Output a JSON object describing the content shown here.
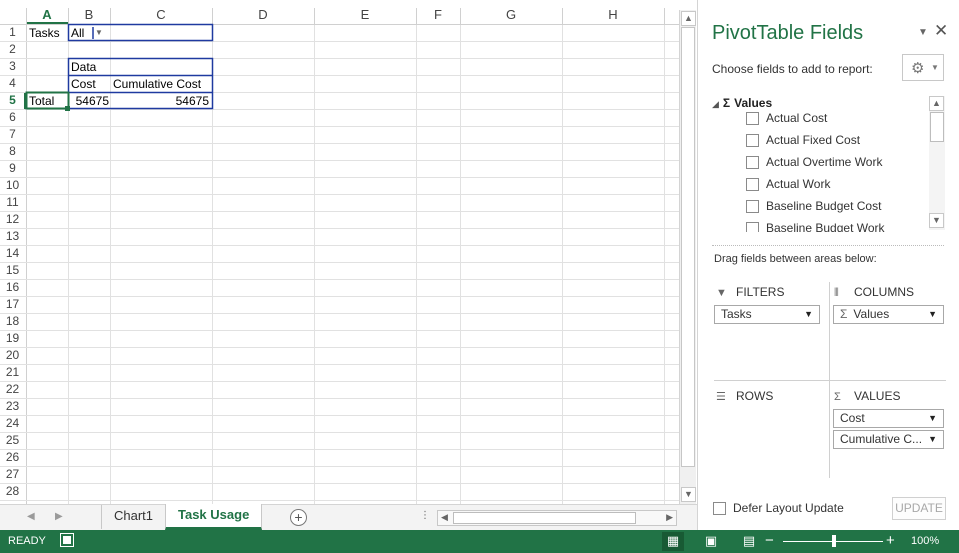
{
  "sheet": {
    "columns": [
      "A",
      "B",
      "C",
      "D",
      "E",
      "F",
      "G",
      "H"
    ],
    "rows": [
      "1",
      "2",
      "3",
      "4",
      "5",
      "6",
      "7",
      "8",
      "9",
      "10",
      "11",
      "12",
      "13",
      "14",
      "15",
      "16",
      "17",
      "18",
      "19",
      "20",
      "21",
      "22",
      "23",
      "24",
      "25",
      "26",
      "27",
      "28"
    ],
    "active_column": "A",
    "active_row": "5",
    "cells": {
      "a1": "Tasks",
      "b1": "All",
      "b3": "Data",
      "b4": "Cost",
      "c4": "Cumulative Cost",
      "a5": "Total",
      "b5": "54675",
      "c5": "54675"
    }
  },
  "tabs": {
    "items": [
      "Chart1",
      "Task Usage"
    ],
    "active": "Task Usage",
    "add_icon": "plus-circle-icon"
  },
  "pivot": {
    "title": "PivotTable Fields",
    "choose_label": "Choose fields to add to report:",
    "values_node": "Values",
    "fields": [
      "Actual Cost",
      "Actual Fixed Cost",
      "Actual Overtime Work",
      "Actual Work",
      "Baseline Budget Cost",
      "Baseline Budget Work"
    ],
    "drag_label": "Drag fields between areas below:",
    "areas": {
      "filters": {
        "label": "FILTERS",
        "items": [
          "Tasks"
        ]
      },
      "columns": {
        "label": "COLUMNS",
        "items": [
          "Values"
        ]
      },
      "rows": {
        "label": "ROWS",
        "items": []
      },
      "values": {
        "label": "VALUES",
        "items": [
          "Cost",
          "Cumulative C..."
        ]
      }
    },
    "defer_label": "Defer Layout Update",
    "update_label": "UPDATE"
  },
  "status": {
    "ready": "READY",
    "zoom": "100%"
  },
  "colors": {
    "accent": "#217346",
    "pivot_border": "#1f3aa0",
    "grid": "#e1e1e1"
  }
}
